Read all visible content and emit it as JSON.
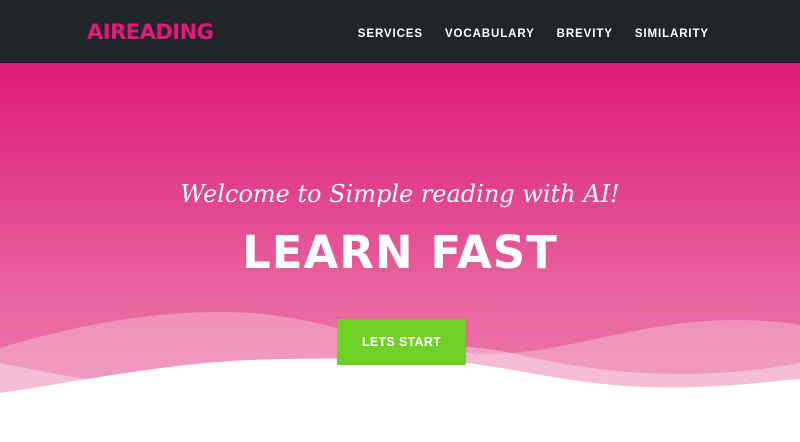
{
  "navbar": {
    "brand": "AIREADING",
    "brand_color": "#e0197a",
    "background": "#212529",
    "links": [
      {
        "label": "SERVICES"
      },
      {
        "label": "VOCABULARY"
      },
      {
        "label": "BREVITY"
      },
      {
        "label": "SIMILARITY"
      }
    ]
  },
  "hero": {
    "subheading": "Welcome to Simple reading with AI!",
    "heading": "LEARN FAST",
    "cta_label": "LETS START",
    "accent_color": "#e01b79",
    "cta_color": "#6fd125"
  }
}
